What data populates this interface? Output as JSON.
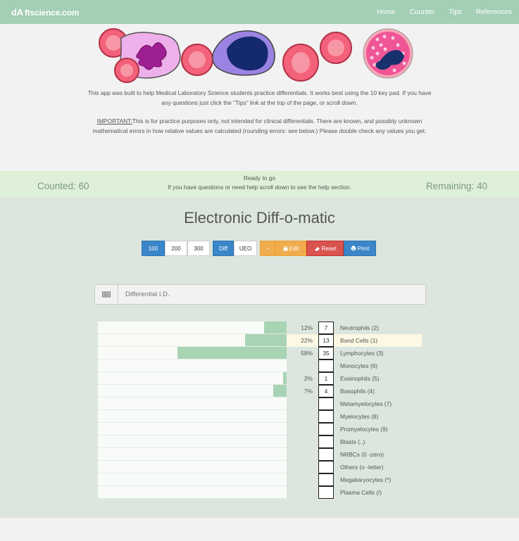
{
  "navbar": {
    "brand": "ftscience.com",
    "brand_logo": "dA",
    "links": [
      "Home",
      "Counter",
      "Tips",
      "References"
    ]
  },
  "intro": {
    "p1": "This app was built to help Medical Laboratory Science students practice differentials. It works best using the 10 key pad. If you have any questions just click the \"Tips\" link at the top of the page, or scroll down.",
    "p2_label": "IMPORTANT:",
    "p2": "This is for practice purposes only, not intended for clinical differentials. There are known, and possibly unknown mathematical errors in how relative values are calculated (rounding errors: see below.) Please double check any values you get."
  },
  "status": {
    "counted": "Counted: 60",
    "remaining": "Remaining: 40",
    "message": "Ready to go",
    "help": "If you have questions or need help scroll down to see the help section."
  },
  "app": {
    "title": "Electronic Diff-o-matic",
    "buttons": {
      "b100": "100",
      "b200": "200",
      "b300": "300",
      "diff": "Diff",
      "ueo": "UEO",
      "minus": "−",
      "edit": "Edit",
      "reset": "Reset",
      "print": "Print"
    },
    "input_placeholder": "Differential I.D."
  },
  "colors": {
    "navbar": "#a3cfb4",
    "status_bg": "#dff0d8",
    "main_bg": "#dce6de",
    "bar_fill": "#a8d4b4",
    "highlight_row": "#fcf8e3",
    "btn_blue": "#3a86c8",
    "btn_orange": "#f0ad4e",
    "btn_red": "#d9534f"
  },
  "cells": [
    {
      "name": "Neutrophils (2)",
      "count": "7",
      "pct": "12%",
      "fraction": 0.12
    },
    {
      "name": "Band Cells (1)",
      "count": "13",
      "pct": "22%",
      "fraction": 0.22
    },
    {
      "name": "Lymphocytes (3)",
      "count": "35",
      "pct": "58%",
      "fraction": 0.58
    },
    {
      "name": "Monocytes (6)",
      "count": "",
      "pct": "",
      "fraction": 0
    },
    {
      "name": "Eosinophils (5)",
      "count": "1",
      "pct": "2%",
      "fraction": 0.02
    },
    {
      "name": "Basophils (4)",
      "count": "4",
      "pct": "7%",
      "fraction": 0.07
    },
    {
      "name": "Metamyelocytes (7)",
      "count": "",
      "pct": "",
      "fraction": 0
    },
    {
      "name": "Myelocytes (8)",
      "count": "",
      "pct": "",
      "fraction": 0
    },
    {
      "name": "Promyelocytes (9)",
      "count": "",
      "pct": "",
      "fraction": 0
    },
    {
      "name": "Blasts (..)",
      "count": "",
      "pct": "",
      "fraction": 0
    },
    {
      "name": "NRBCs (0 -zero)",
      "count": "",
      "pct": "",
      "fraction": 0
    },
    {
      "name": "Others (o -letter)",
      "count": "",
      "pct": "",
      "fraction": 0
    },
    {
      "name": "Megakaryocytes (*)",
      "count": "",
      "pct": "",
      "fraction": 0
    },
    {
      "name": "Plasma Cells (/)",
      "count": "",
      "pct": "",
      "fraction": 0
    }
  ]
}
